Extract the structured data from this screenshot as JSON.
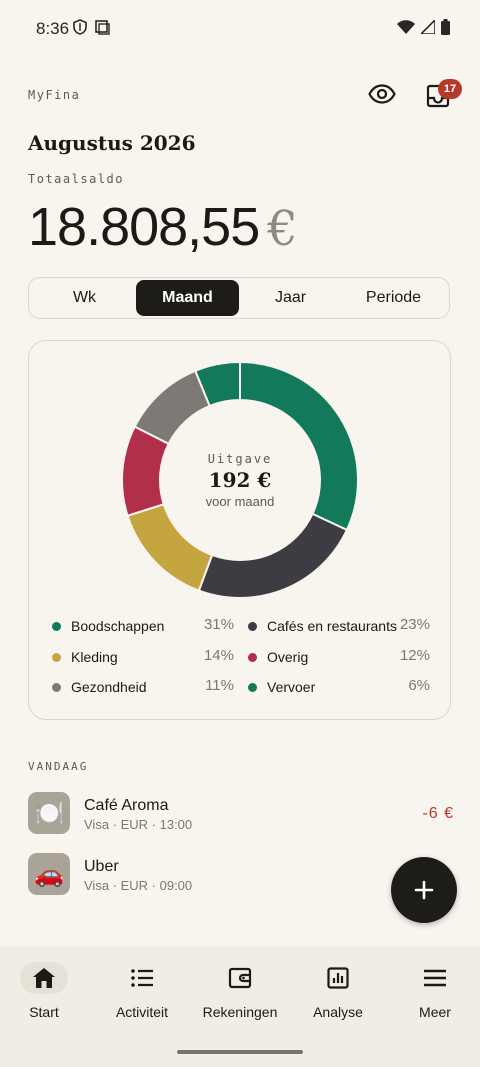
{
  "status_bar": {
    "time": "8:36"
  },
  "header": {
    "brand": "MyFina",
    "inbox_badge": "17",
    "month_title": "Augustus 2026",
    "balance_label": "Totaalsaldo",
    "balance_amount": "18.808,55",
    "balance_currency": "€"
  },
  "period_tabs": {
    "items": [
      "Wk",
      "Maand",
      "Jaar",
      "Periode"
    ],
    "selected": "Maand"
  },
  "chart_data": {
    "type": "pie",
    "categories": [
      "Boodschappen",
      "Cafés en restaurants",
      "Kleding",
      "Overig",
      "Gezondheid",
      "Vervoer"
    ],
    "values": [
      31,
      23,
      14,
      12,
      11,
      6
    ],
    "percent_labels": [
      "31%",
      "23%",
      "14%",
      "12%",
      "11%",
      "6%"
    ],
    "colors": [
      "#127a5a",
      "#3d3c42",
      "#c5a540",
      "#b22f4b",
      "#7d7a75",
      "#127a5a"
    ],
    "center_label": "Uitgave",
    "center_amount": "192 €",
    "center_sub": "voor maand"
  },
  "transactions": {
    "section_label": "VANDAAG",
    "items": [
      {
        "title": "Café Aroma",
        "meta": "Visa · EUR · 13:00",
        "amount": "-6 €",
        "icon": "🍽️"
      },
      {
        "title": "Uber",
        "meta": "Visa · EUR · 09:00",
        "amount": "",
        "icon": "🚗"
      }
    ]
  },
  "bottom_nav": {
    "items": [
      "Start",
      "Activiteit",
      "Rekeningen",
      "Analyse",
      "Meer"
    ],
    "active": "Start"
  }
}
